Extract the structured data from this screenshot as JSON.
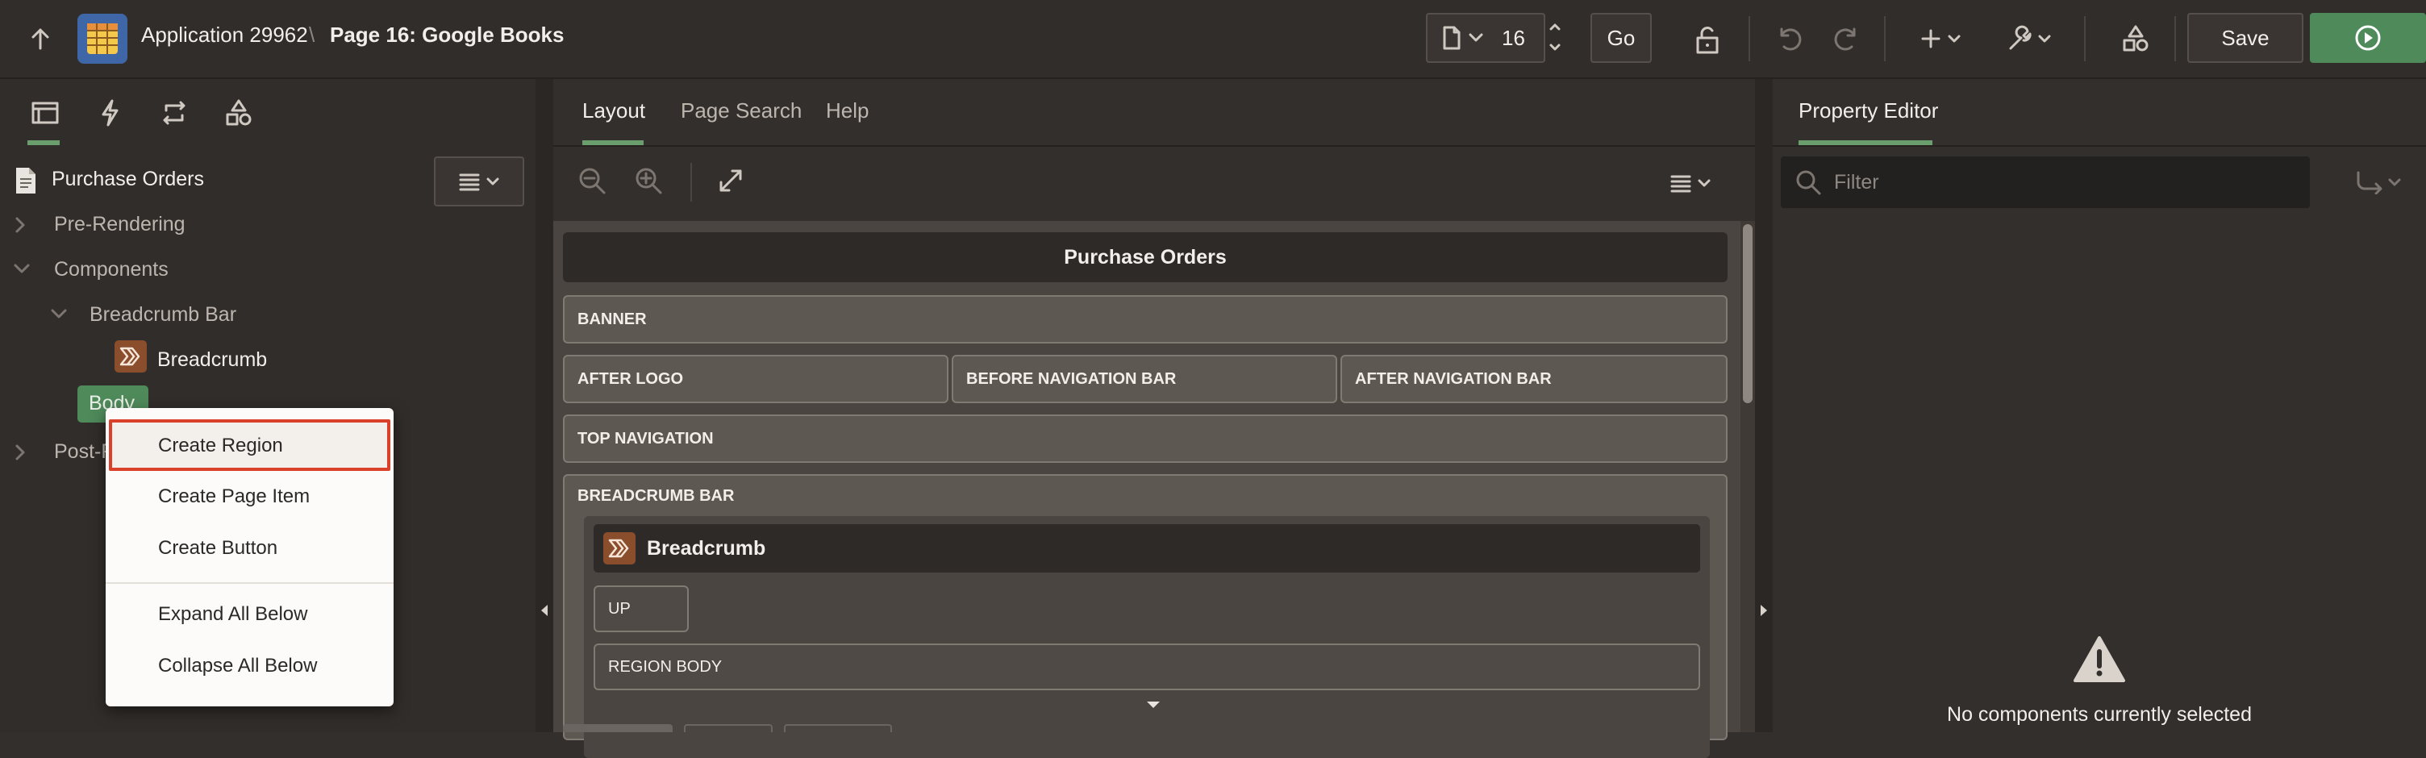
{
  "toolbar": {
    "app_name": "Application 29962",
    "separator": "\\",
    "page_title": "Page 16: Google Books",
    "page_number": "16",
    "go_label": "Go",
    "save_label": "Save"
  },
  "left_pane": {
    "root": "Purchase Orders",
    "tree": {
      "pre_rendering": "Pre-Rendering",
      "components": "Components",
      "breadcrumb_bar": "Breadcrumb Bar",
      "breadcrumb": "Breadcrumb",
      "body": "Body",
      "post_rendering": "Post-R"
    }
  },
  "context_menu": {
    "items": [
      "Create Region",
      "Create Page Item",
      "Create Button",
      "Expand All Below",
      "Collapse All Below"
    ]
  },
  "center_pane": {
    "tabs": [
      "Layout",
      "Page Search",
      "Help"
    ],
    "page_header": "Purchase Orders",
    "slots": {
      "banner": "BANNER",
      "after_logo": "AFTER LOGO",
      "before_nav": "BEFORE NAVIGATION BAR",
      "after_nav": "AFTER NAVIGATION BAR",
      "top_nav": "TOP NAVIGATION",
      "breadcrumb_bar": "BREADCRUMB BAR",
      "breadcrumb_region": "Breadcrumb",
      "up": "UP",
      "region_body": "REGION BODY"
    }
  },
  "right_pane": {
    "tab": "Property Editor",
    "filter_placeholder": "Filter",
    "empty_message": "No components currently selected"
  },
  "colors": {
    "accent_green": "#6a9e6d",
    "run_button": "#4f8a5b",
    "highlight_red": "#d9412b"
  }
}
